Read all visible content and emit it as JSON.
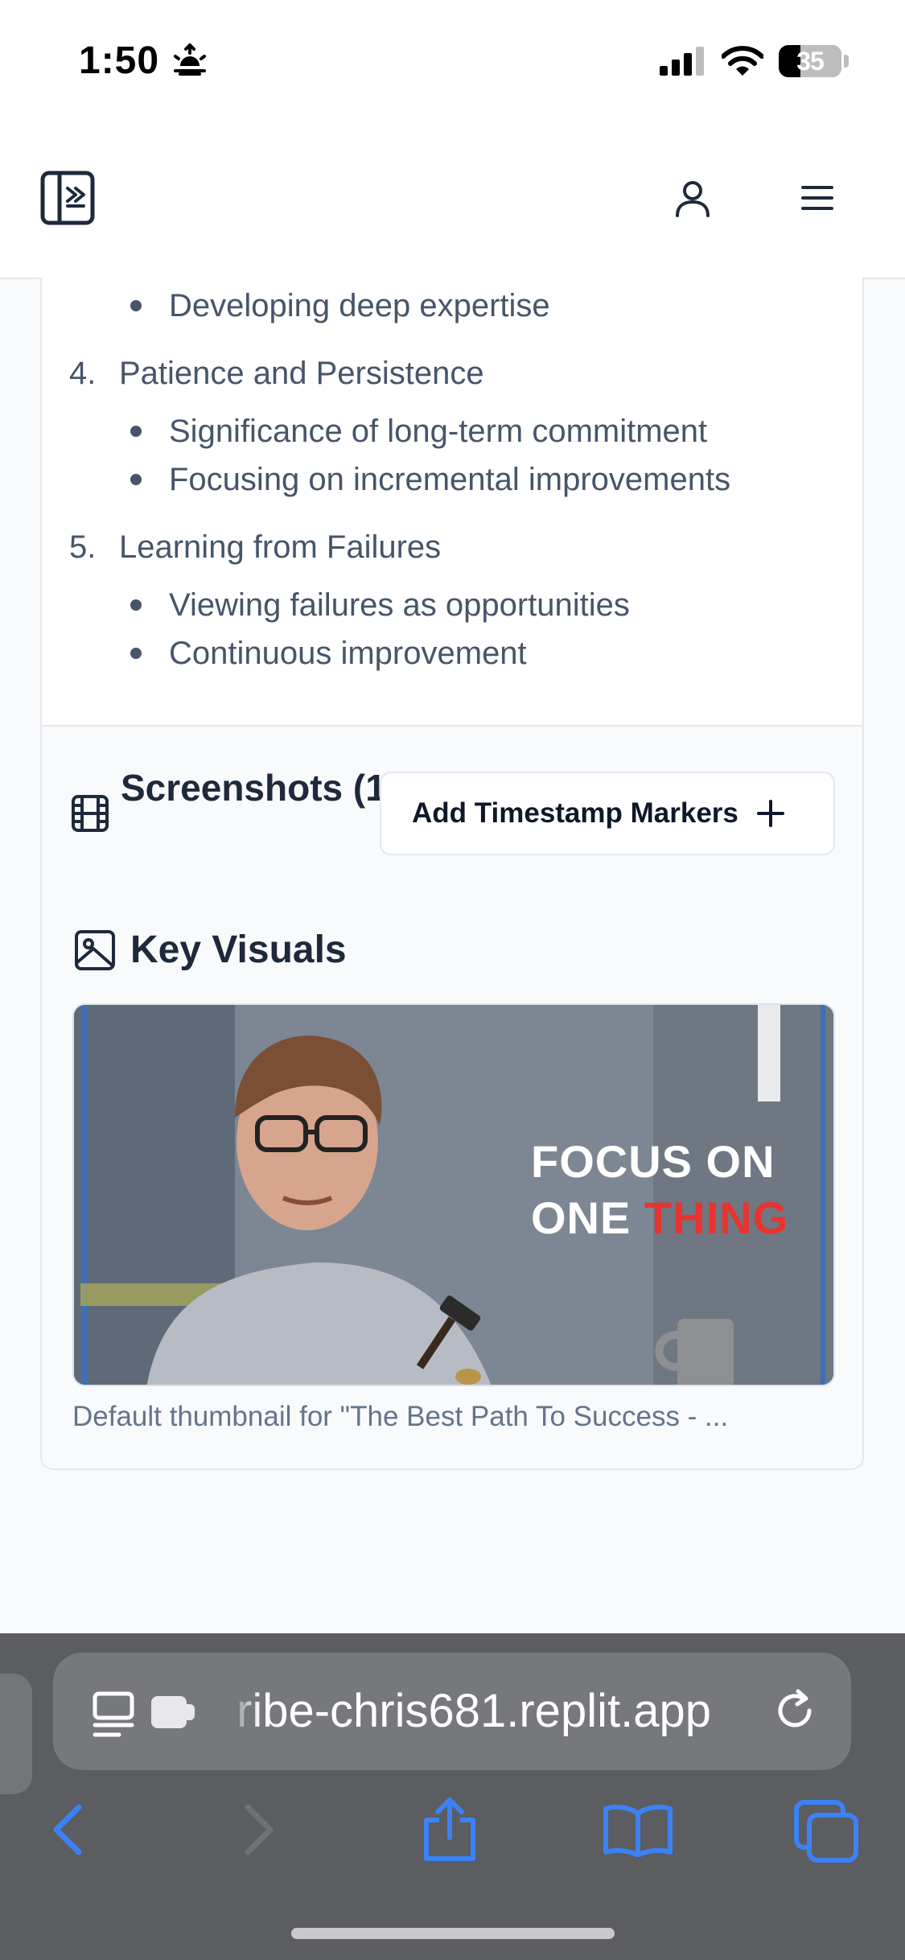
{
  "status_bar": {
    "time": "1:50",
    "battery_percent": "35",
    "battery_level": 0.35
  },
  "outline": {
    "top_bullet": "Developing deep expertise",
    "items": [
      {
        "number": "4.",
        "title": "Patience and Persistence",
        "bullets": [
          "Significance of long-term commitment",
          "Focusing on incremental improvements"
        ]
      },
      {
        "number": "5.",
        "title": "Learning from Failures",
        "bullets": [
          "Viewing failures as opportunities",
          "Continuous improvement"
        ]
      }
    ]
  },
  "screenshots": {
    "title": "Screenshots (1)",
    "add_markers_label": "Add Timestamp Markers"
  },
  "key_visuals": {
    "title": "Key Visuals",
    "thumbnail_text_line1": "FOCUS ON",
    "thumbnail_text_line2_white": "ONE ",
    "thumbnail_text_line2_red": "THING",
    "caption": "Default thumbnail for \"The Best Path To Success - ..."
  },
  "browser": {
    "url": "ribe-chris681.replit.app"
  },
  "icons": {
    "logo": "sidebar-toggle-icon",
    "user": "user-icon",
    "menu": "hamburger-menu-icon",
    "film": "film-icon",
    "image": "image-icon",
    "plus": "plus-icon"
  },
  "colors": {
    "text_primary": "#1e293b",
    "text_muted": "#475569",
    "safari_blue": "#3b82f6",
    "highlight_red": "#e8342e"
  }
}
